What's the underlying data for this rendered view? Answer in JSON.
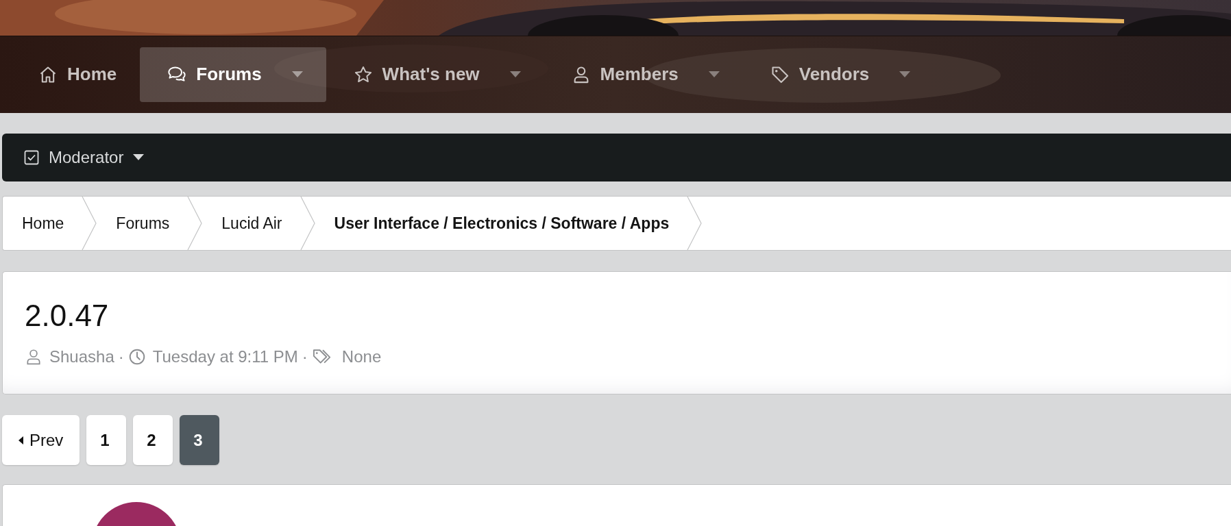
{
  "nav": {
    "items": [
      {
        "label": "Home",
        "selected": false,
        "has_menu": false
      },
      {
        "label": "Forums",
        "selected": true,
        "has_menu": true
      },
      {
        "label": "What's new",
        "selected": false,
        "has_menu": true
      },
      {
        "label": "Members",
        "selected": false,
        "has_menu": true
      },
      {
        "label": "Vendors",
        "selected": false,
        "has_menu": true
      }
    ]
  },
  "moderator_bar": {
    "label": "Moderator"
  },
  "breadcrumbs": [
    {
      "label": "Home",
      "current": false
    },
    {
      "label": "Forums",
      "current": false
    },
    {
      "label": "Lucid Air",
      "current": false
    },
    {
      "label": "User Interface / Electronics / Software / Apps",
      "current": true
    }
  ],
  "thread": {
    "title": "2.0.47",
    "meta": [
      {
        "kind": "author",
        "text": "Shuasha"
      },
      {
        "kind": "separator",
        "text": "·"
      },
      {
        "kind": "date",
        "text": "Tuesday at 9:11 PM"
      },
      {
        "kind": "separator",
        "text": "·"
      },
      {
        "kind": "tags",
        "text": "None"
      }
    ]
  },
  "pagination": {
    "prev": "Prev",
    "pages": [
      {
        "label": "1",
        "selected": false
      },
      {
        "label": "2",
        "selected": false
      },
      {
        "label": "3",
        "selected": true
      }
    ]
  }
}
